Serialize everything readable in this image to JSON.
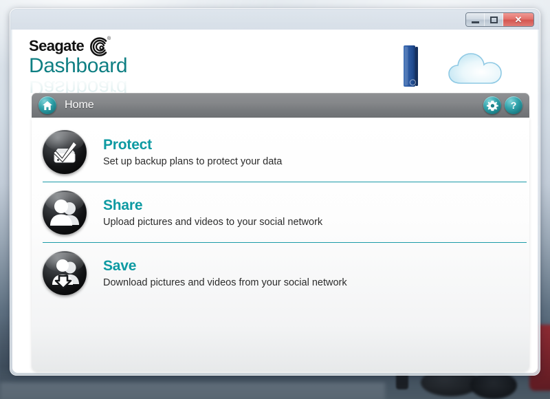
{
  "window": {
    "titlebar": {
      "minimize_label": "",
      "maximize_label": "",
      "close_label": "✕"
    }
  },
  "header": {
    "brand": "Seagate",
    "brand_registered": "®",
    "product": "Dashboard",
    "reflection": "Dashboard",
    "device_icon": "external-hard-drive-icon",
    "cloud_icon": "cloud-icon"
  },
  "navbar": {
    "home_icon": "home-icon",
    "title": "Home",
    "settings_icon": "gear-icon",
    "help_icon": "question-mark-icon"
  },
  "main": {
    "rows": [
      {
        "icon": "backup-drive-check-icon",
        "title": "Protect",
        "description": "Set up backup plans to protect your data"
      },
      {
        "icon": "two-people-icon",
        "title": "Share",
        "description": "Upload pictures and videos to your social network"
      },
      {
        "icon": "people-download-arrow-icon",
        "title": "Save",
        "description": "Download pictures and videos from your social network"
      }
    ]
  },
  "colors": {
    "teal": "#0d9aa2",
    "teal_dark": "#0f7f83",
    "divider": "#1a9aa8",
    "navbar_gray": "#7b7e81",
    "close_red": "#d4564f"
  }
}
